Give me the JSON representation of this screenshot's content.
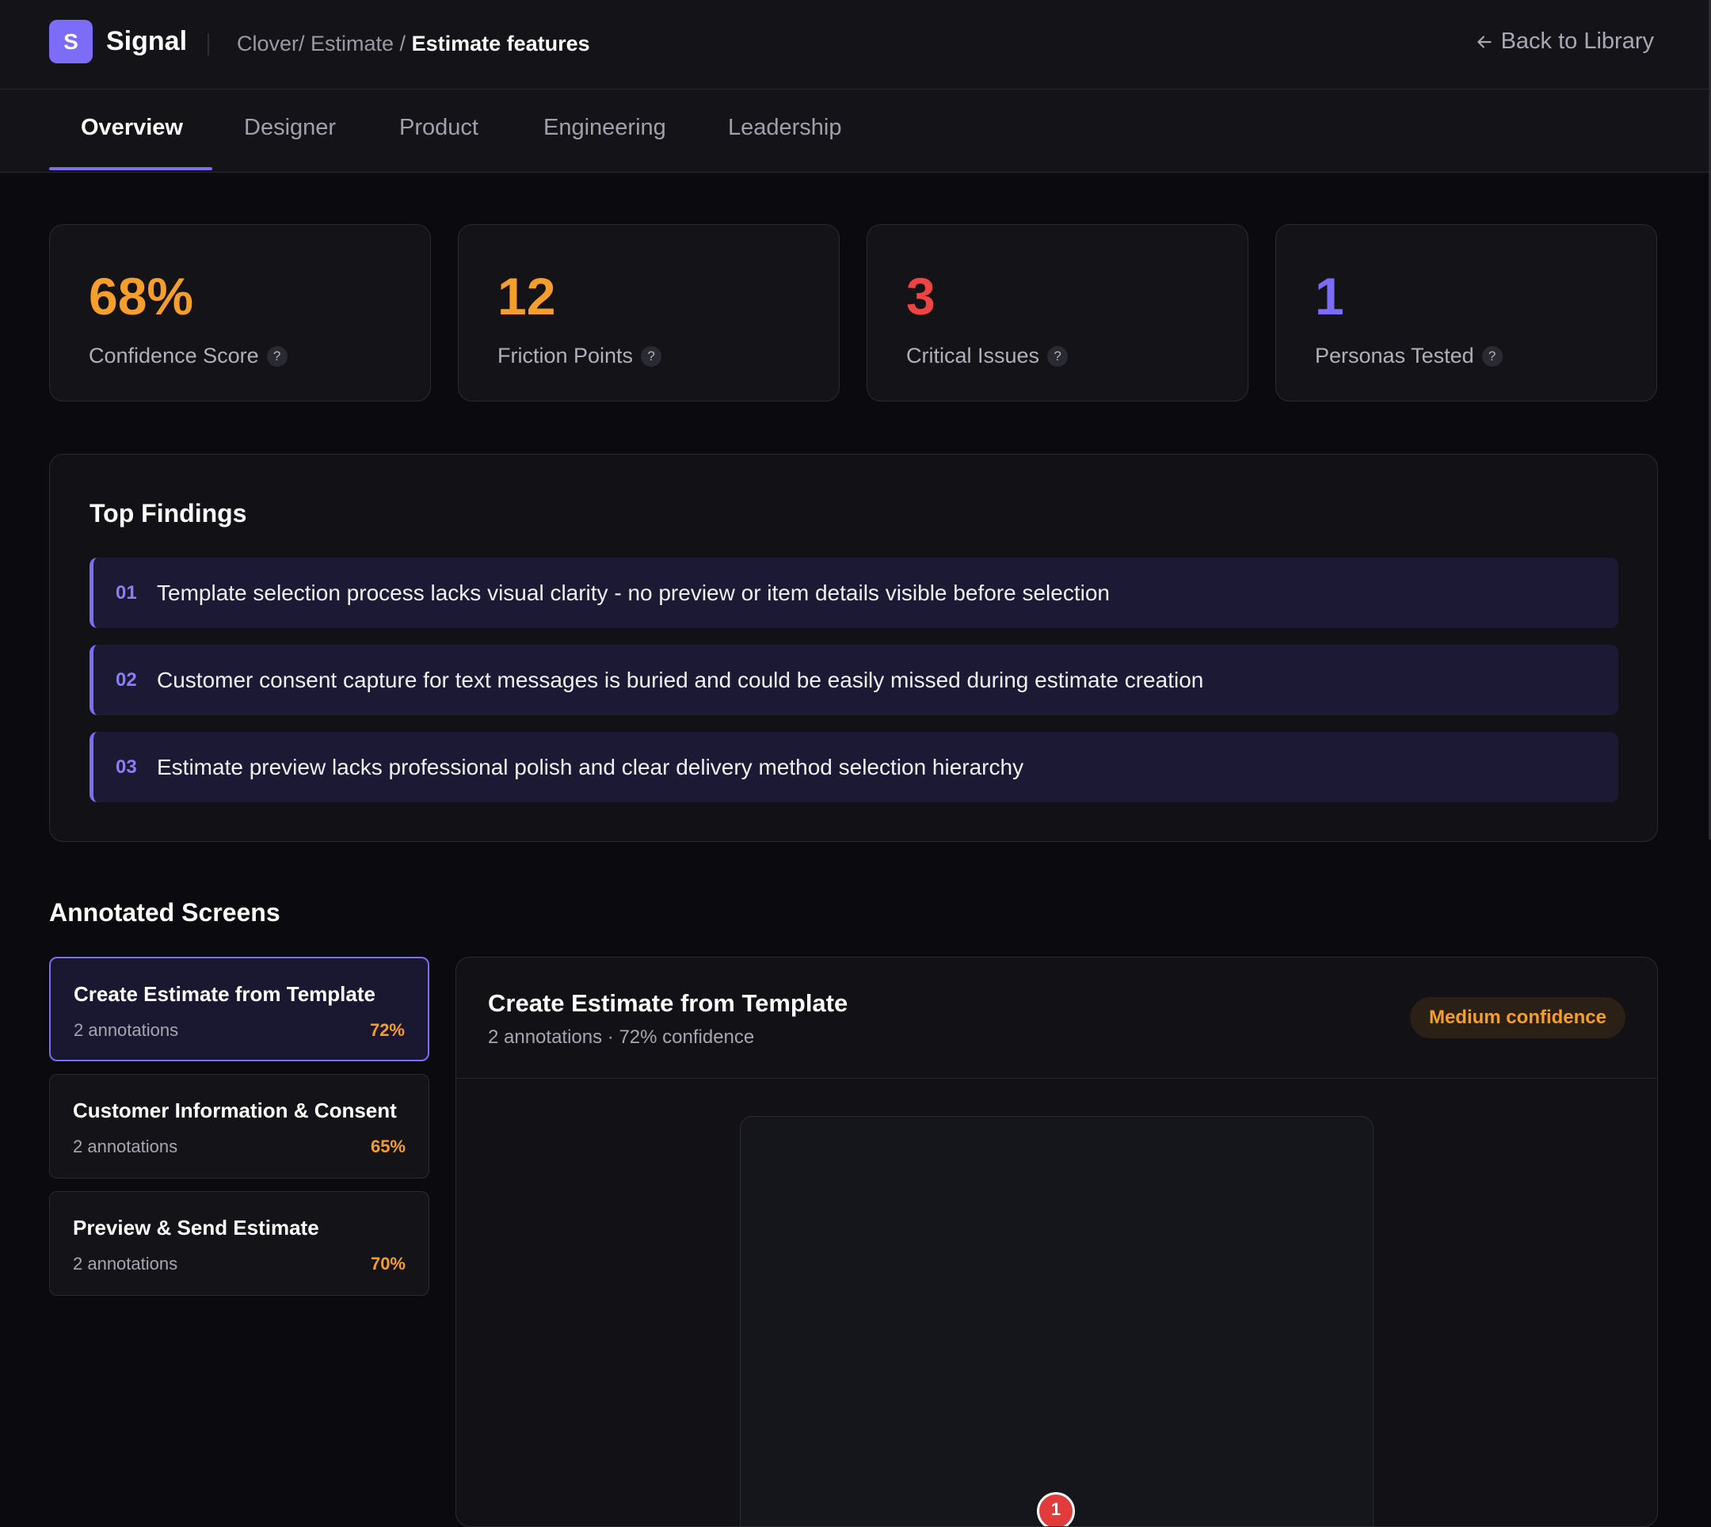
{
  "app": {
    "logo_letter": "S",
    "name": "Signal"
  },
  "breadcrumb": {
    "path": "Clover/ Estimate / ",
    "current": "Estimate features"
  },
  "back_link": {
    "label": "Back to Library",
    "icon": "arrow-left-icon"
  },
  "tabs": [
    {
      "label": "Overview",
      "active": true
    },
    {
      "label": "Designer",
      "active": false
    },
    {
      "label": "Product",
      "active": false
    },
    {
      "label": "Engineering",
      "active": false
    },
    {
      "label": "Leadership",
      "active": false
    }
  ],
  "stats": [
    {
      "value": "68%",
      "label": "Confidence Score",
      "color": "#f59e2b"
    },
    {
      "value": "12",
      "label": "Friction Points",
      "color": "#f59e2b"
    },
    {
      "value": "3",
      "label": "Critical Issues",
      "color": "#ef4444"
    },
    {
      "value": "1",
      "label": "Personas Tested",
      "color": "#7c6cf6"
    }
  ],
  "help_glyph": "?",
  "findings": {
    "title": "Top Findings",
    "items": [
      {
        "num": "01",
        "text": "Template selection process lacks visual clarity - no preview or item details visible before selection"
      },
      {
        "num": "02",
        "text": "Customer consent capture for text messages is buried and could be easily missed during estimate creation"
      },
      {
        "num": "03",
        "text": "Estimate preview lacks professional polish and clear delivery method selection hierarchy"
      }
    ]
  },
  "annotated": {
    "title": "Annotated Screens",
    "screens": [
      {
        "name": "Create Estimate from Template",
        "annotations": "2 annotations",
        "pct": "72%",
        "selected": true
      },
      {
        "name": "Customer Information & Consent",
        "annotations": "2 annotations",
        "pct": "65%",
        "selected": false
      },
      {
        "name": "Preview & Send Estimate",
        "annotations": "2 annotations",
        "pct": "70%",
        "selected": false
      }
    ]
  },
  "detail": {
    "title": "Create Estimate from Template",
    "subtitle": "2 annotations · 72% confidence",
    "badge": "Medium confidence",
    "marker": "1"
  }
}
